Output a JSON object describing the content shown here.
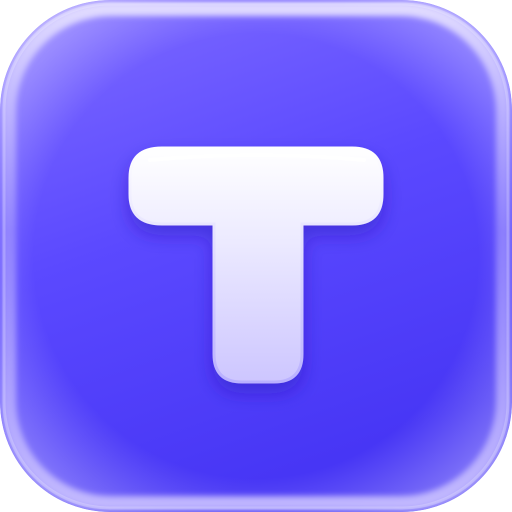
{
  "app_icon": {
    "glyph": "T",
    "background_gradient": [
      "#7f6cff",
      "#5b49ff",
      "#4736f5"
    ],
    "rim_color": "#c9c0ff",
    "glyph_gradient": [
      "#ffffff",
      "#eceaff",
      "#cdc6ff"
    ],
    "glyph_shadow": "#2c1fb8"
  }
}
